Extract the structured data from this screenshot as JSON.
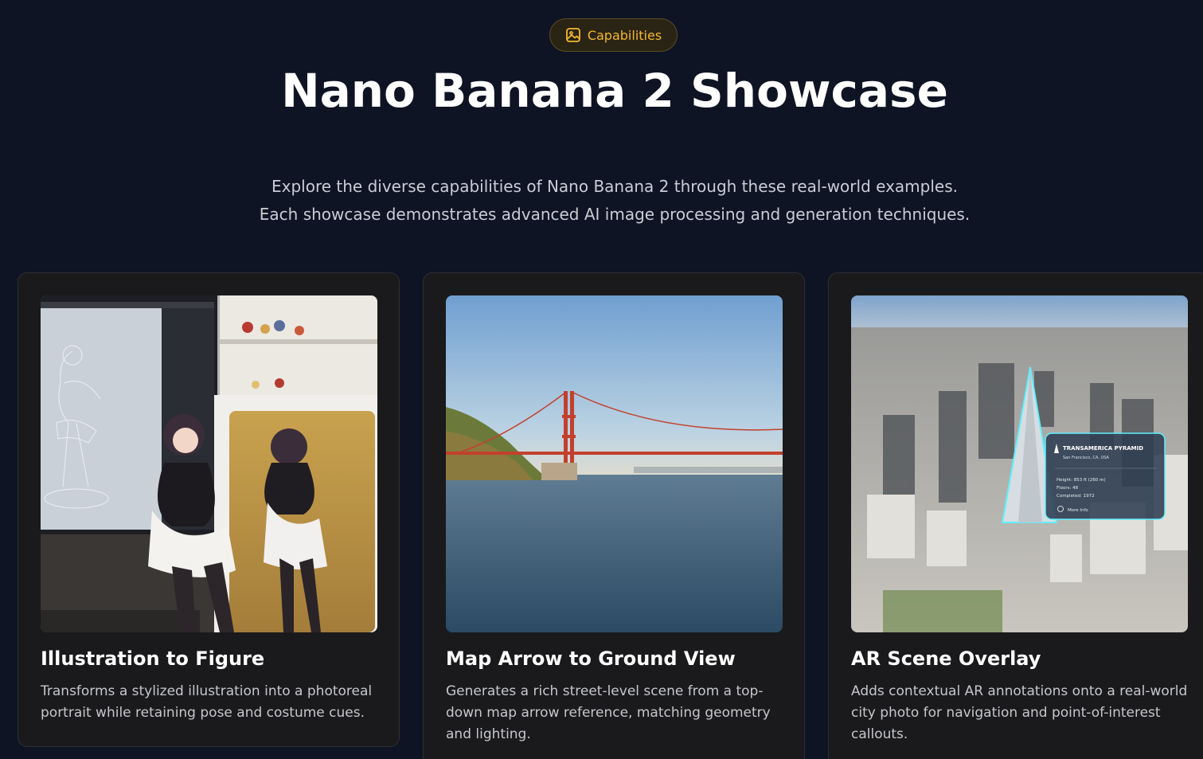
{
  "badge": {
    "icon": "image-icon",
    "label": "Capabilities",
    "color": "#f5b82e"
  },
  "header": {
    "title": "Nano Banana 2 Showcase",
    "subtitle_line1": "Explore the diverse capabilities of Nano Banana 2 through these real-world examples.",
    "subtitle_line2": "Each showcase demonstrates advanced AI image processing and generation techniques."
  },
  "cards": [
    {
      "title": "Illustration to Figure",
      "description": "Transforms a stylized illustration into a photoreal portrait while retaining pose and costume cues.",
      "image": "anime-figure-photo"
    },
    {
      "title": "Map Arrow to Ground View",
      "description": "Generates a rich street-level scene from a top-down map arrow reference, matching geometry and lighting.",
      "image": "golden-gate-bridge-photo"
    },
    {
      "title": "AR Scene Overlay",
      "description": "Adds contextual AR annotations onto a real-world city photo for navigation and point-of-interest callouts.",
      "image": "city-ar-overlay-photo",
      "overlay": {
        "name": "TRANSAMERICA PYRAMID",
        "location": "San Francisco, CA, USA",
        "height": "Height: 853 ft (260 m)",
        "floors": "Floors: 48",
        "completed": "Completed: 1972",
        "more": "More Info"
      }
    }
  ]
}
